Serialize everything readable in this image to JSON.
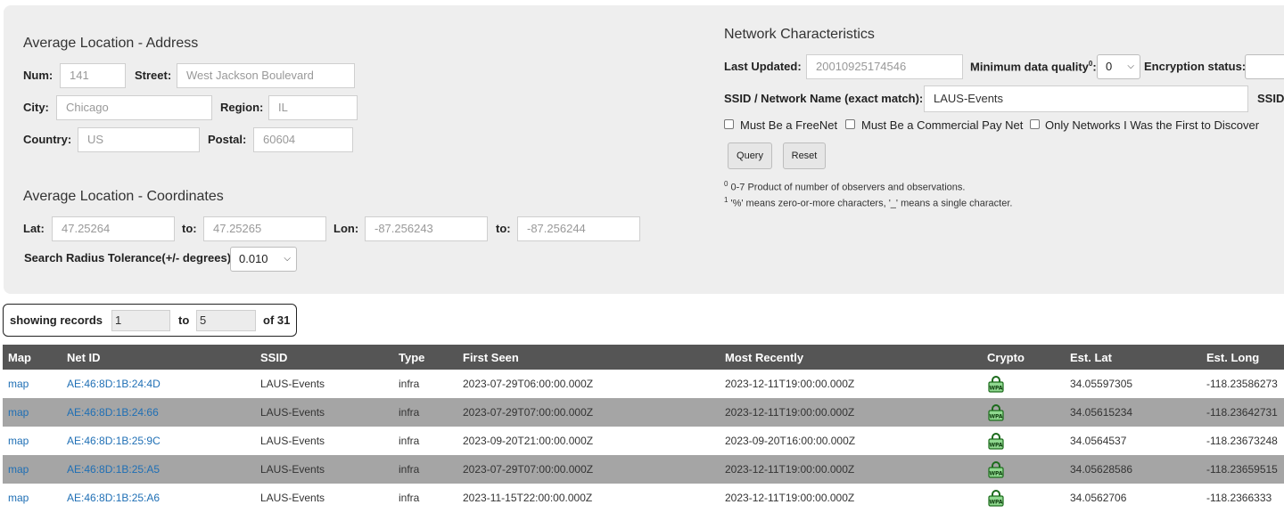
{
  "address": {
    "heading": "Average Location - Address",
    "num_label": "Num:",
    "num_value": "141",
    "street_label": "Street:",
    "street_value": "West Jackson Boulevard",
    "city_label": "City:",
    "city_value": "Chicago",
    "region_label": "Region:",
    "region_value": "IL",
    "country_label": "Country:",
    "country_value": "US",
    "postal_label": "Postal:",
    "postal_value": "60604"
  },
  "coords": {
    "heading": "Average Location - Coordinates",
    "lat_label": "Lat:",
    "lat_from": "47.25264",
    "to_label": "to:",
    "lat_to": "47.25265",
    "lon_label": "Lon:",
    "lon_from": "-87.256243",
    "lon_to": "-87.256244",
    "radius_label": "Search Radius Tolerance(+/- degrees):",
    "radius_value": "0.010"
  },
  "network": {
    "heading": "Network Characteristics",
    "last_updated_label": "Last Updated:",
    "last_updated_value": "20010925174546",
    "min_quality_label": "Minimum data quality",
    "min_quality_sup": "0",
    "min_quality_colon": ":",
    "min_quality_value": "0",
    "encryption_label": "Encryption status:",
    "ssid_label": "SSID / Network Name (exact match):",
    "ssid_value": "LAUS-Events",
    "ssid_label2": "SSID",
    "freenet_label": "Must Be a FreeNet",
    "paynet_label": "Must Be a Commercial Pay Net",
    "first_label": "Only Networks I Was the First to Discover",
    "query_label": "Query",
    "reset_label": "Reset",
    "note1_sup": "0",
    "note1": " 0-7 Product of number of observers and observations.",
    "note2_sup": "1",
    "note2": " '%' means zero-or-more characters, '_' means a single character."
  },
  "pager": {
    "showing_label": "showing records",
    "from": "1",
    "to_label": "to",
    "to": "5",
    "of_label": "of 31"
  },
  "table": {
    "headers": [
      "Map",
      "Net ID",
      "SSID",
      "Type",
      "First Seen",
      "Most Recently",
      "Crypto",
      "Est. Lat",
      "Est. Long"
    ],
    "rows": [
      {
        "map": "map",
        "netid": "AE:46:8D:1B:24:4D",
        "ssid": "LAUS-Events",
        "type": "infra",
        "first": "2023-07-29T06:00:00.000Z",
        "recent": "2023-12-11T19:00:00.000Z",
        "crypto": "WPA",
        "lat": "34.05597305",
        "lon": "-118.23586273"
      },
      {
        "map": "map",
        "netid": "AE:46:8D:1B:24:66",
        "ssid": "LAUS-Events",
        "type": "infra",
        "first": "2023-07-29T07:00:00.000Z",
        "recent": "2023-12-11T19:00:00.000Z",
        "crypto": "WPA",
        "lat": "34.05615234",
        "lon": "-118.23642731"
      },
      {
        "map": "map",
        "netid": "AE:46:8D:1B:25:9C",
        "ssid": "LAUS-Events",
        "type": "infra",
        "first": "2023-09-20T21:00:00.000Z",
        "recent": "2023-09-20T16:00:00.000Z",
        "crypto": "WPA",
        "lat": "34.0564537",
        "lon": "-118.23673248"
      },
      {
        "map": "map",
        "netid": "AE:46:8D:1B:25:A5",
        "ssid": "LAUS-Events",
        "type": "infra",
        "first": "2023-07-29T07:00:00.000Z",
        "recent": "2023-12-11T19:00:00.000Z",
        "crypto": "WPA",
        "lat": "34.05628586",
        "lon": "-118.23659515"
      },
      {
        "map": "map",
        "netid": "AE:46:8D:1B:25:A6",
        "ssid": "LAUS-Events",
        "type": "infra",
        "first": "2023-11-15T22:00:00.000Z",
        "recent": "2023-12-11T19:00:00.000Z",
        "crypto": "WPA",
        "lat": "34.0562706",
        "lon": "-118.2366333"
      }
    ]
  }
}
